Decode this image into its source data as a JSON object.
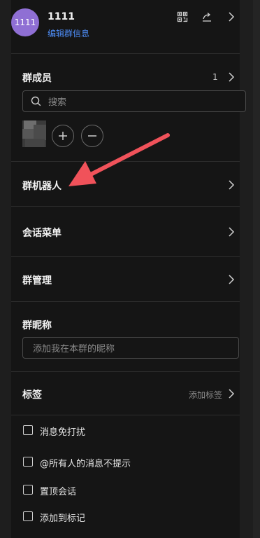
{
  "header": {
    "avatar_text": "1111",
    "group_name": "1111",
    "edit_link": "编辑群信息",
    "icons": [
      "qrcode-icon",
      "share-icon",
      "chevron-right-icon"
    ]
  },
  "members": {
    "title": "群成员",
    "count": "1",
    "search_placeholder": "搜索",
    "add_icon": "plus-icon",
    "remove_icon": "minus-icon"
  },
  "bots": {
    "title": "群机器人"
  },
  "session_menu": {
    "title": "会话菜单"
  },
  "management": {
    "title": "群管理"
  },
  "nickname": {
    "title": "群昵称",
    "placeholder": "添加我在本群的昵称"
  },
  "tags": {
    "title": "标签",
    "action": "添加标签"
  },
  "options": [
    {
      "label": "消息免打扰",
      "checked": false
    },
    {
      "label": "@所有人的消息不提示",
      "checked": false
    },
    {
      "label": "置顶会话",
      "checked": false
    },
    {
      "label": "添加到标记",
      "checked": false
    }
  ],
  "colors": {
    "background": "#151515",
    "accent": "#4d8cf5",
    "avatar": "#8f6fd4",
    "annotation_arrow": "#f0525a"
  }
}
